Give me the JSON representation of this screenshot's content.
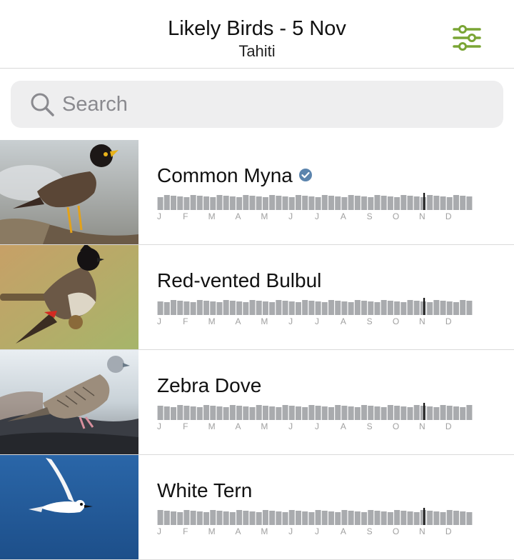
{
  "header": {
    "title": "Likely Birds - 5 Nov",
    "subtitle": "Tahiti",
    "filter_icon": "sliders-icon",
    "accent_color": "#7aa535"
  },
  "search": {
    "placeholder": "Search",
    "value": ""
  },
  "months": [
    "J",
    "F",
    "M",
    "A",
    "M",
    "J",
    "J",
    "A",
    "S",
    "O",
    "N",
    "D"
  ],
  "current_marker": "5 Nov",
  "birds": [
    {
      "name": "Common Myna",
      "verified": true,
      "image": "common-myna-photo"
    },
    {
      "name": "Red-vented Bulbul",
      "verified": false,
      "image": "red-vented-bulbul-photo"
    },
    {
      "name": "Zebra Dove",
      "verified": false,
      "image": "zebra-dove-photo"
    },
    {
      "name": "White Tern",
      "verified": false,
      "image": "white-tern-photo"
    }
  ]
}
